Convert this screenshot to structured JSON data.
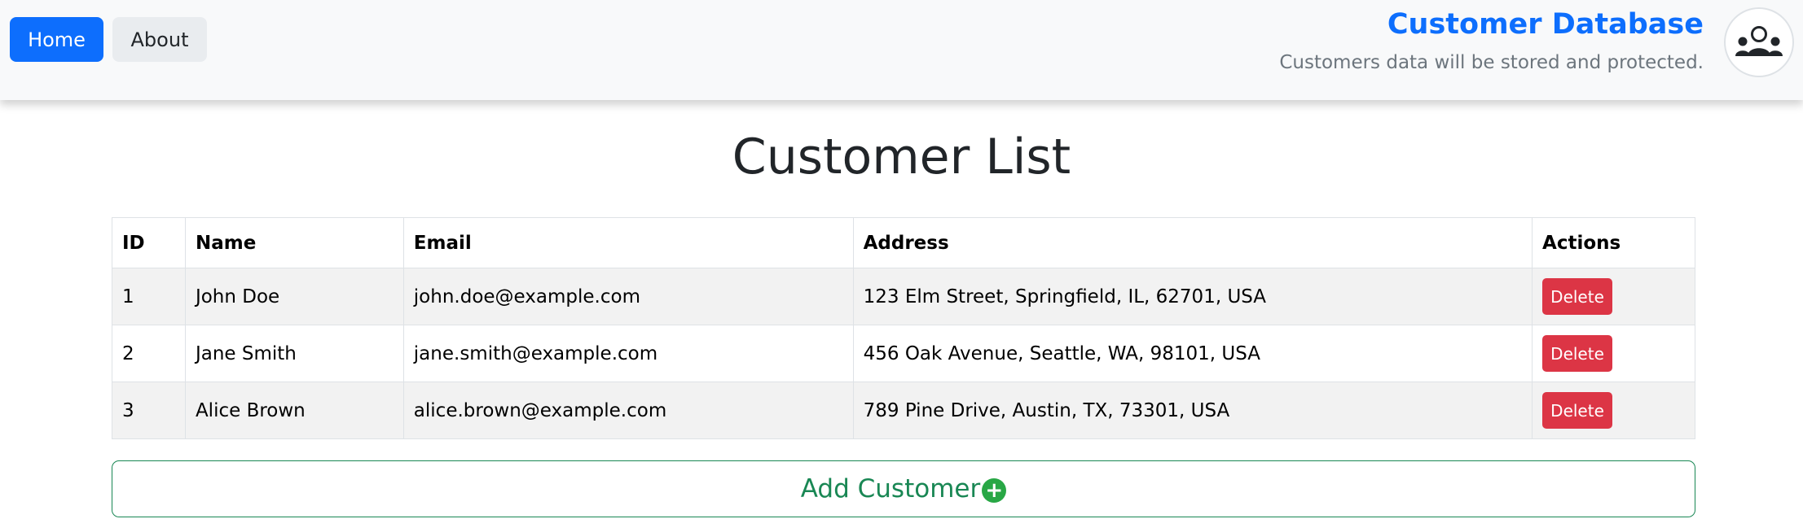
{
  "nav": {
    "home_label": "Home",
    "about_label": "About"
  },
  "brand": {
    "title": "Customer Database",
    "subtitle": "Customers data will be stored and protected.",
    "avatar_icon": "users-icon"
  },
  "main": {
    "title": "Customer List",
    "columns": [
      "ID",
      "Name",
      "Email",
      "Address",
      "Actions"
    ],
    "rows": [
      {
        "id": "1",
        "name": "John Doe",
        "email": "john.doe@example.com",
        "address": "123 Elm Street, Springfield, IL, 62701, USA",
        "action": "Delete"
      },
      {
        "id": "2",
        "name": "Jane Smith",
        "email": "jane.smith@example.com",
        "address": "456 Oak Avenue, Seattle, WA, 98101, USA",
        "action": "Delete"
      },
      {
        "id": "3",
        "name": "Alice Brown",
        "email": "alice.brown@example.com",
        "address": "789 Pine Drive, Austin, TX, 73301, USA",
        "action": "Delete"
      }
    ],
    "add_label": "Add Customer",
    "add_icon": "plus-circle-icon"
  },
  "colors": {
    "primary": "#0d6efd",
    "danger": "#dc3545",
    "success": "#198754"
  }
}
